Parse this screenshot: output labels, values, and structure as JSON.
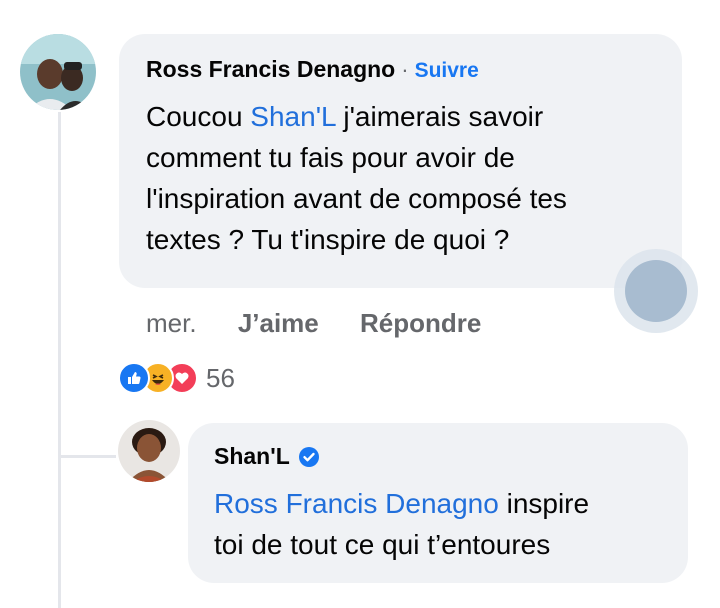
{
  "comment": {
    "author": "Ross Francis Denagno",
    "separator": "·",
    "follow_label": "Suivre",
    "text_lines": [
      {
        "before": "Coucou ",
        "mention": "Shan'L",
        "after": " j'aimerais savoir"
      },
      {
        "text": "comment tu fais pour avoir de"
      },
      {
        "text": "l'inspiration avant de composé tes"
      },
      {
        "text": "textes ? Tu t'inspire de quoi ?"
      }
    ],
    "time": "mer.",
    "like_label": "J’aime",
    "reply_label": "Répondre",
    "reaction_count": "56",
    "reaction_icons": [
      "like-icon",
      "haha-icon",
      "love-icon"
    ]
  },
  "reply": {
    "author": "Shan'L",
    "verified_icon": "verified-badge-icon",
    "mention": "Ross Francis Denagno",
    "text_after_mention": " inspire",
    "text_line2": "toi de tout ce qui t’entoures"
  },
  "colors": {
    "accent": "#1877f2",
    "bubble": "#f0f2f5",
    "muted": "#65676b"
  }
}
